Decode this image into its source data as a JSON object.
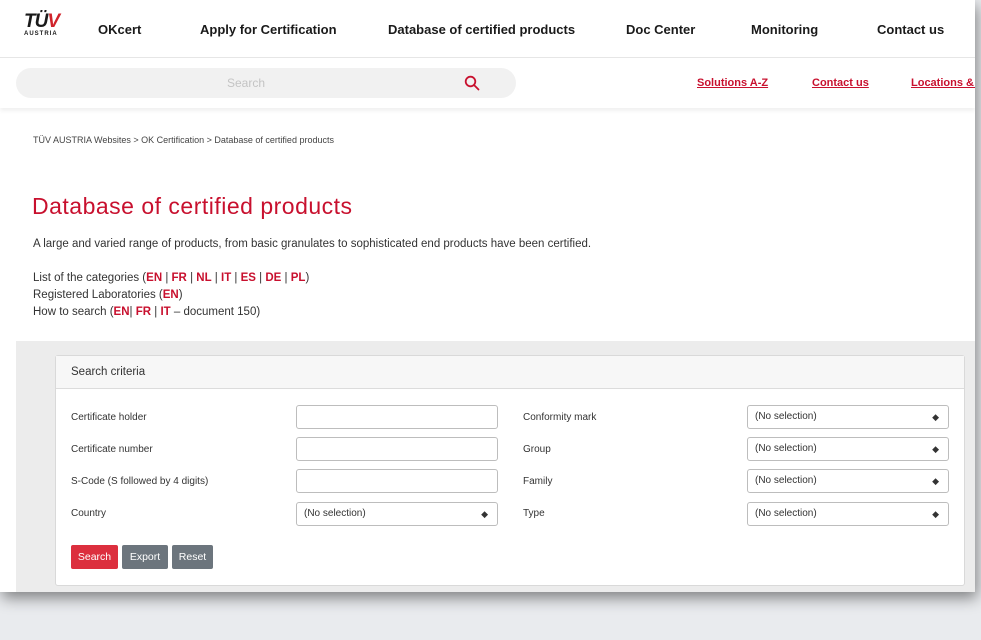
{
  "logo": {
    "mark_main": "TÜ",
    "mark_v": "V",
    "sub": "AUSTRIA"
  },
  "nav": {
    "items": [
      "OKcert",
      "Apply for Certification",
      "Database of certified products",
      "Doc Center",
      "Monitoring",
      "Contact us"
    ]
  },
  "subbar": {
    "search_placeholder": "Search",
    "links": [
      "Solutions A-Z",
      "Contact us",
      "Locations & I"
    ]
  },
  "breadcrumb": "TÜV AUSTRIA Websites > OK Certification > Database of certified products",
  "page_title": "Database of certified products",
  "intro": "A large and varied range of products, from basic granulates to sophisticated end products have been certified.",
  "categories": {
    "prefix": "List of the categories (",
    "langs": [
      "EN",
      "FR",
      "NL",
      "IT",
      "ES",
      "DE",
      "PL"
    ],
    "suffix": ")"
  },
  "labs": {
    "prefix": "Registered Laboratories (",
    "lang": "EN",
    "suffix": ")"
  },
  "howto": {
    "prefix": "How to search (",
    "langs": [
      "EN",
      "FR",
      "IT"
    ],
    "suffix": " – document 150)"
  },
  "form": {
    "header": "Search criteria",
    "left": [
      {
        "label": "Certificate holder",
        "type": "input",
        "value": ""
      },
      {
        "label": "Certificate number",
        "type": "input",
        "value": ""
      },
      {
        "label": "S-Code (S followed by 4 digits)",
        "type": "input",
        "value": ""
      },
      {
        "label": "Country",
        "type": "select",
        "value": "(No selection)"
      }
    ],
    "right": [
      {
        "label": "Conformity mark",
        "type": "select",
        "value": "(No selection)"
      },
      {
        "label": "Group",
        "type": "select",
        "value": "(No selection)"
      },
      {
        "label": "Family",
        "type": "select",
        "value": "(No selection)"
      },
      {
        "label": "Type",
        "type": "select",
        "value": "(No selection)"
      }
    ],
    "buttons": {
      "search": "Search",
      "export": "Export",
      "reset": "Reset"
    }
  },
  "colors": {
    "accent": "#c8102e",
    "button_primary": "#dc2f3e",
    "button_secondary": "#6c757d"
  }
}
